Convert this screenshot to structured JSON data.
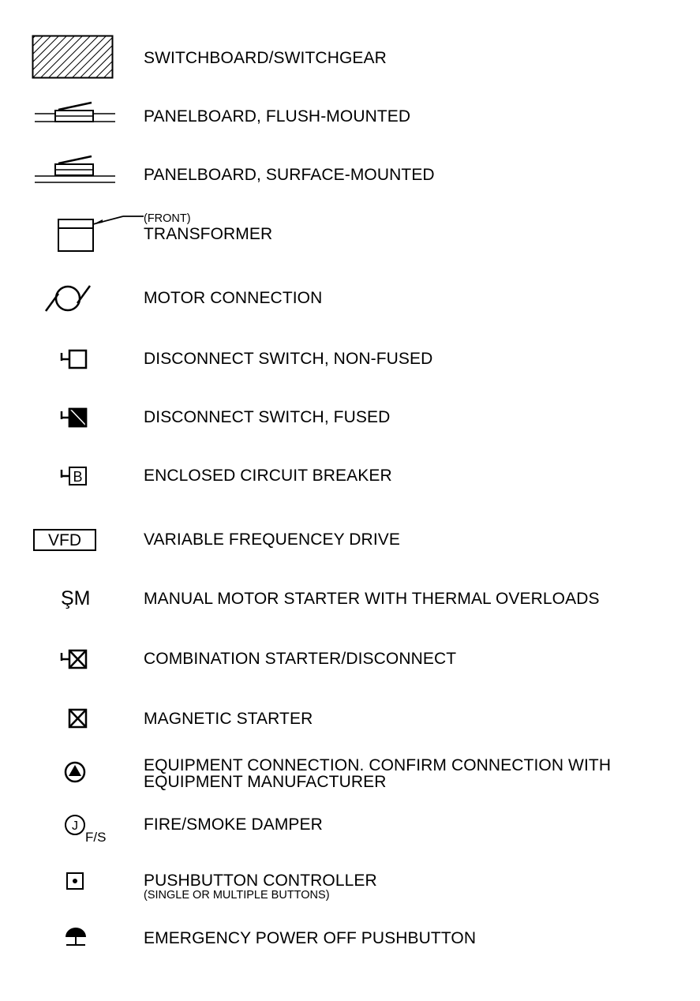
{
  "legend": {
    "switchboard": "SWITCHBOARD/SWITCHGEAR",
    "panel_flush": "PANELBOARD, FLUSH-MOUNTED",
    "panel_surface": "PANELBOARD, SURFACE-MOUNTED",
    "transformer_note": "(FRONT)",
    "transformer": "TRANSFORMER",
    "motor": "MOTOR CONNECTION",
    "disc_nonfused": "DISCONNECT SWITCH, NON-FUSED",
    "disc_fused": "DISCONNECT SWITCH, FUSED",
    "breaker_symbol": "B",
    "breaker": "ENCLOSED CIRCUIT BREAKER",
    "vfd_symbol": "VFD",
    "vfd": "VARIABLE FREQUENCEY DRIVE",
    "manual_symbol": "ŞM",
    "manual_starter": "MANUAL MOTOR STARTER WITH THERMAL OVERLOADS",
    "combo": "COMBINATION STARTER/DISCONNECT",
    "magnetic": "MAGNETIC STARTER",
    "equip_line1": "EQUIPMENT CONNECTION. CONFIRM CONNECTION WITH",
    "equip_line2": "EQUIPMENT MANUFACTURER",
    "damper_symbol": "J",
    "damper_sub": "F/S",
    "damper": "FIRE/SMOKE DAMPER",
    "pushbutton": "PUSHBUTTON CONTROLLER",
    "pushbutton_note": "(SINGLE OR MULTIPLE BUTTONS)",
    "epo": "EMERGENCY POWER OFF PUSHBUTTON"
  }
}
